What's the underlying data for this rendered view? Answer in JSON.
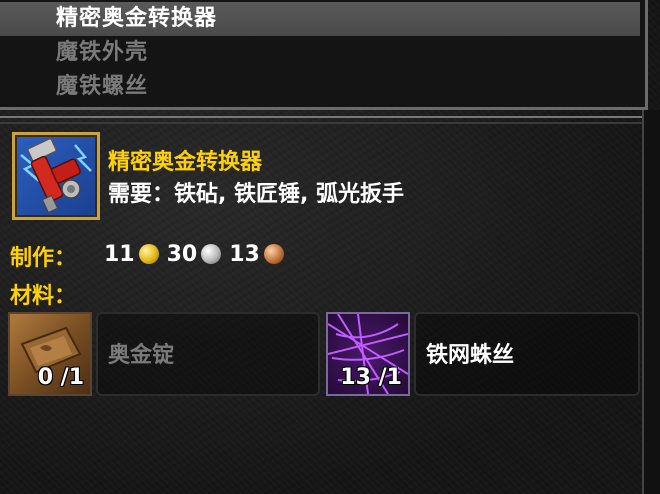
{
  "recipe_list": {
    "items": [
      {
        "label": "精密奥金转换器",
        "selected": true
      },
      {
        "label": "魔铁外壳",
        "selected": false
      },
      {
        "label": "魔铁螺丝",
        "selected": false
      }
    ]
  },
  "detail": {
    "icon": "wrench-gadget-icon",
    "title": "精密奥金转换器",
    "requires": "需要：铁砧, 铁匠锤, 弧光扳手",
    "cost_label": "制作：",
    "cost": {
      "gold": "11",
      "silver": "30",
      "copper": "13"
    },
    "materials_label": "材料："
  },
  "reagents": [
    {
      "name": "奥金锭",
      "count": "0 /1",
      "icon": "adamantite-bar-icon",
      "available": false
    },
    {
      "name": "铁网蛛丝",
      "count": "13 /1",
      "icon": "spider-silk-icon",
      "available": true
    }
  ],
  "colors": {
    "title": "#ffd100",
    "selected_row": "#4f4f4f",
    "dim_text": "#7a7a7a",
    "icon_border": "#c8a341"
  }
}
